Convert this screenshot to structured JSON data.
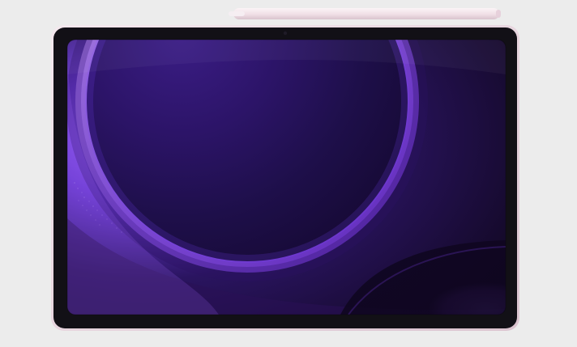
{
  "scene": {
    "subject": "",
    "colors": {
      "background": "#ececec",
      "frame": "#ead9e2",
      "bezel": "#121016",
      "screen_base": "#1b0b32",
      "screen_glow": "#a067ff",
      "stylus": "#f4e8ec"
    },
    "icons": {
      "stylus": "stylus-icon",
      "camera": "camera-icon",
      "tablet": "tablet-icon"
    }
  }
}
